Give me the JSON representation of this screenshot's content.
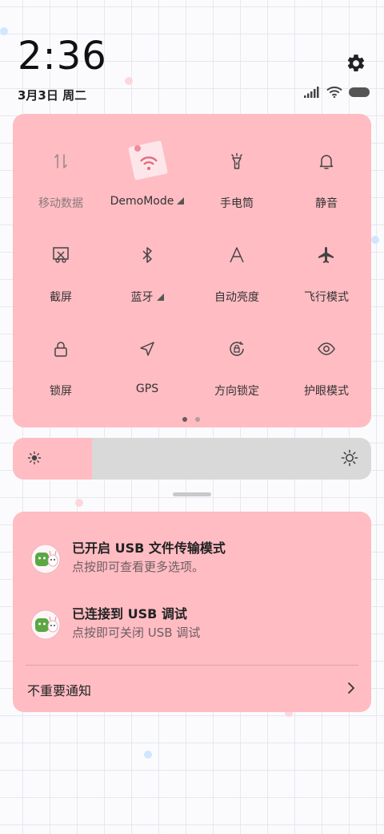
{
  "status_bar": {
    "time": "2:36",
    "date": "3月3日 周二",
    "icons": [
      "signal-icon",
      "wifi-icon",
      "battery-icon"
    ]
  },
  "quick_settings": {
    "tiles": [
      {
        "label": "移动数据",
        "icon": "mobile-data-icon",
        "state": "off"
      },
      {
        "label": "DemoMode",
        "icon": "wifi-icon",
        "state": "on",
        "expandable": true
      },
      {
        "label": "手电筒",
        "icon": "flashlight-icon",
        "state": "off"
      },
      {
        "label": "静音",
        "icon": "bell-icon",
        "state": "off"
      },
      {
        "label": "截屏",
        "icon": "screenshot-icon",
        "state": "off"
      },
      {
        "label": "蓝牙",
        "icon": "bluetooth-icon",
        "state": "off",
        "expandable": true
      },
      {
        "label": "自动亮度",
        "icon": "auto-brightness-icon",
        "state": "off"
      },
      {
        "label": "飞行模式",
        "icon": "airplane-icon",
        "state": "off"
      },
      {
        "label": "锁屏",
        "icon": "lock-icon",
        "state": "off"
      },
      {
        "label": "GPS",
        "icon": "location-icon",
        "state": "off"
      },
      {
        "label": "方向锁定",
        "icon": "rotation-lock-icon",
        "state": "off"
      },
      {
        "label": "护眼模式",
        "icon": "eye-icon",
        "state": "off"
      }
    ],
    "page_count": 2,
    "current_page": 1
  },
  "brightness": {
    "level": 0.22,
    "accent": "#ffbcc3"
  },
  "notifications": [
    {
      "title": "已开启 USB 文件传输模式",
      "subtitle": "点按即可查看更多选项。",
      "icon": "android-system-icon"
    },
    {
      "title": "已连接到 USB 调试",
      "subtitle": "点按即可关闭 USB 调试",
      "icon": "android-system-icon"
    }
  ],
  "unimportant_label": "不重要通知",
  "colors": {
    "panel": "#ffbcc3",
    "slider_track": "#d9d9d9",
    "text": "#222222"
  }
}
